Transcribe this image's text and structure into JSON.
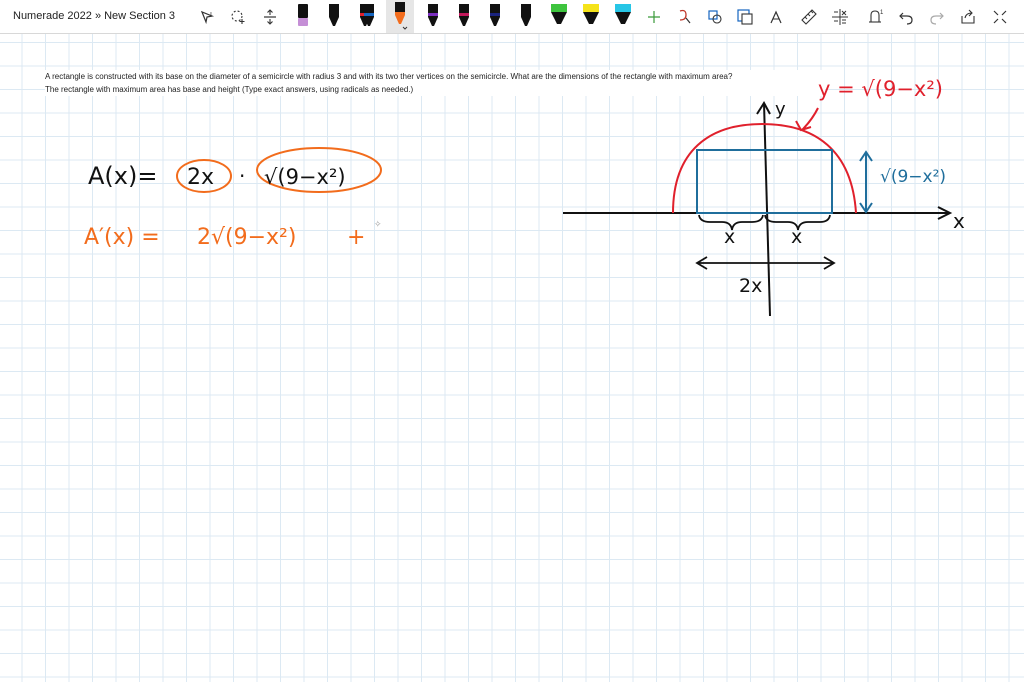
{
  "breadcrumb": "Numerade 2022 » New Section 3",
  "colors": {
    "accent_orange": "#f26c1c",
    "curve_red": "#e0202c",
    "rect_blue": "#1f6e9c",
    "ink_black": "#111111",
    "grid": "#dce9f3"
  },
  "toolbar": {
    "tools": [
      {
        "name": "lasso-select-icon"
      },
      {
        "name": "shape-select-icon"
      },
      {
        "name": "add-space-icon"
      },
      {
        "name": "pen-purple",
        "color": "#8a3aa8"
      },
      {
        "name": "pen-black",
        "color": "#111111"
      },
      {
        "name": "pen-red",
        "color": "#e0202c"
      },
      {
        "name": "pen-blue",
        "color": "#1565c0"
      },
      {
        "name": "pen-orange-selected",
        "color": "#f26c1c"
      },
      {
        "name": "pen-violet",
        "color": "#7b2fbf"
      },
      {
        "name": "pen-magenta",
        "color": "#c2185b"
      },
      {
        "name": "pen-navy",
        "color": "#1a237e"
      },
      {
        "name": "pen-dark",
        "color": "#202020"
      },
      {
        "name": "highlighter-green",
        "color": "#3ec43e"
      },
      {
        "name": "highlighter-yellow",
        "color": "#f5e31a"
      },
      {
        "name": "highlighter-cyan",
        "color": "#27c6e6"
      },
      {
        "name": "add-pen-icon"
      },
      {
        "name": "ink-to-text-icon"
      },
      {
        "name": "ink-to-shape-icon"
      },
      {
        "name": "shapes-icon"
      },
      {
        "name": "ruler-icon"
      },
      {
        "name": "math-icon"
      },
      {
        "name": "replay-icon"
      },
      {
        "name": "undo-icon"
      },
      {
        "name": "redo-icon"
      },
      {
        "name": "share-icon"
      },
      {
        "name": "expand-icon"
      }
    ]
  },
  "question": {
    "line1": "A rectangle is constructed with its base on the diameter of a semicircle with radius 3 and with its two ther vertices on the semicircle. What are the dimensions of the rectangle with maximum area?",
    "line2": "The rectangle with maximum area has base and height (Type exact answers, using radicals as needed.)"
  },
  "notes": {
    "area_lhs": "A(x)=",
    "area_factor_1": "2x",
    "area_dot": "·",
    "area_factor_2": "√(9−x²)",
    "deriv_lhs": "A′(x) =",
    "deriv_rhs": "2√(9−x²)",
    "deriv_plus": "+",
    "curve_label": "y = √(9−x²)",
    "height_label": "√(9−x²)",
    "axis_y": "y",
    "axis_x": "x",
    "half_base_left": "x",
    "half_base_right": "x",
    "base_label": "2x"
  }
}
